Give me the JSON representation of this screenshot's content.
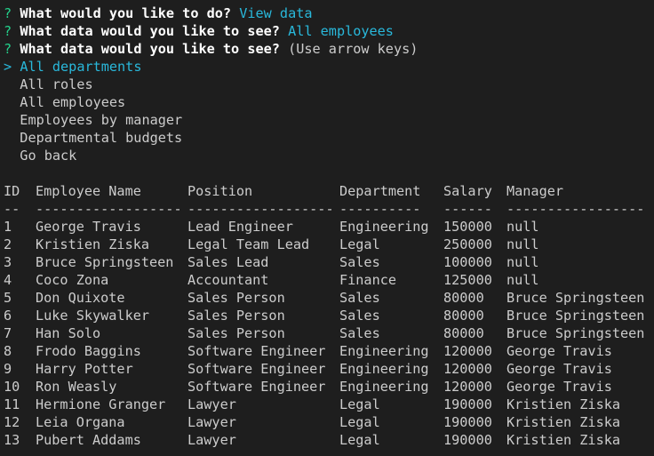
{
  "prompts": [
    {
      "mark": "?",
      "question": "What would you like to do?",
      "answer": "View data"
    },
    {
      "mark": "?",
      "question": "What data would you like to see?",
      "answer": "All employees"
    },
    {
      "mark": "?",
      "question": "What data would you like to see?",
      "hint": "(Use arrow keys)"
    }
  ],
  "menu": {
    "pointer": ">",
    "selected": "All departments",
    "options": [
      "All roles",
      "All employees",
      "Employees by manager",
      "Departmental budgets",
      "Go back"
    ]
  },
  "table": {
    "headers": [
      "ID",
      "Employee Name",
      "Position",
      "Department",
      "Salary",
      "Manager"
    ],
    "dashes": [
      "--",
      "------------------",
      "------------------",
      "----------",
      "------",
      "-----------------"
    ],
    "rows": [
      [
        "1",
        "George Travis",
        "Lead Engineer",
        "Engineering",
        "150000",
        "null"
      ],
      [
        "2",
        "Kristien Ziska",
        "Legal Team Lead",
        "Legal",
        "250000",
        "null"
      ],
      [
        "3",
        "Bruce Springsteen",
        "Sales Lead",
        "Sales",
        "100000",
        "null"
      ],
      [
        "4",
        "Coco Zona",
        "Accountant",
        "Finance",
        "125000",
        "null"
      ],
      [
        "5",
        "Don Quixote",
        "Sales Person",
        "Sales",
        "80000",
        "Bruce Springsteen"
      ],
      [
        "6",
        "Luke Skywalker",
        "Sales Person",
        "Sales",
        "80000",
        "Bruce Springsteen"
      ],
      [
        "7",
        "Han Solo",
        "Sales Person",
        "Sales",
        "80000",
        "Bruce Springsteen"
      ],
      [
        "8",
        "Frodo Baggins",
        "Software Engineer",
        "Engineering",
        "120000",
        "George Travis"
      ],
      [
        "9",
        "Harry Potter",
        "Software Engineer",
        "Engineering",
        "120000",
        "George Travis"
      ],
      [
        "10",
        "Ron Weasly",
        "Software Engineer",
        "Engineering",
        "120000",
        "George Travis"
      ],
      [
        "11",
        "Hermione Granger",
        "Lawyer",
        "Legal",
        "190000",
        "Kristien Ziska"
      ],
      [
        "12",
        "Leia Organa",
        "Lawyer",
        "Legal",
        "190000",
        "Kristien Ziska"
      ],
      [
        "13",
        "Pubert Addams",
        "Lawyer",
        "Legal",
        "190000",
        "Kristien Ziska"
      ]
    ]
  },
  "colors": {
    "background": "#1e1e1e",
    "text": "#cccccc",
    "prompt_mark": "#23d18b",
    "answer": "#29b8db",
    "question": "#ffffff"
  }
}
